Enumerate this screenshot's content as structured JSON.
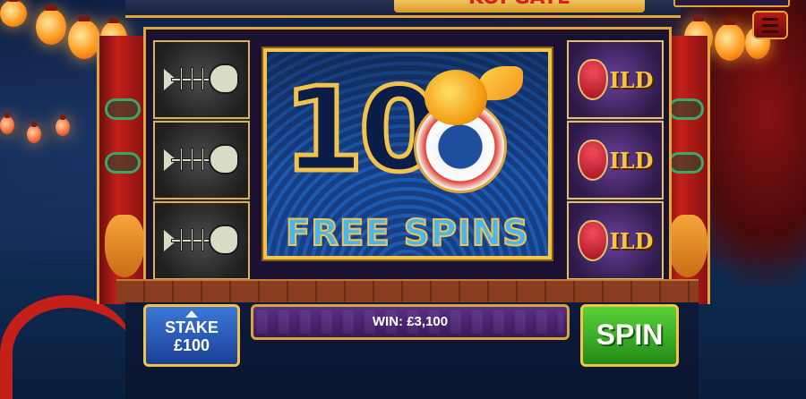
{
  "game": {
    "title": "KOI GATE",
    "menu_icon": "hamburger-menu-icon"
  },
  "reels": {
    "left_reel": [
      "fishbone",
      "fishbone",
      "fishbone"
    ],
    "right_reel": [
      "wild",
      "wild",
      "wild"
    ],
    "wild_text": "ILD"
  },
  "free_spins": {
    "count": "10",
    "label": "FREE SPINS"
  },
  "controls": {
    "stake_label": "STAKE",
    "stake_amount": "£100",
    "win_text": "WIN: £3,100",
    "spin_label": "SPIN"
  },
  "colors": {
    "frame_gold": "#f2c34a",
    "spin_green": "#2fa81f",
    "stake_blue": "#2a5fc4",
    "win_purple": "#4a2470"
  }
}
